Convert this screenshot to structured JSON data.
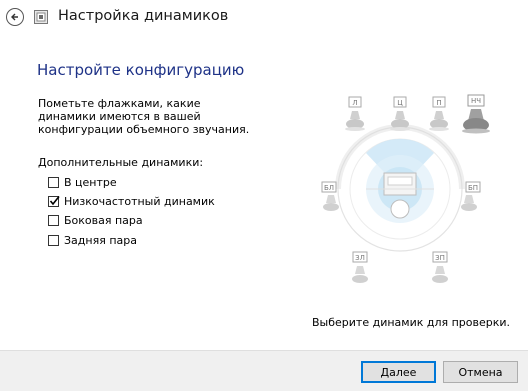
{
  "window": {
    "title": "Настройка динамиков"
  },
  "page": {
    "heading": "Настройте конфигурацию",
    "instructions": "Пометьте флажками, какие динамики имеются в вашей конфигурации объемного звучания.",
    "extra_speakers_label": "Дополнительные динамики:",
    "test_hint": "Выберите динамик для проверки."
  },
  "options": [
    {
      "label": "В центре",
      "checked": false
    },
    {
      "label": "Низкочастотный динамик",
      "checked": true
    },
    {
      "label": "Боковая пара",
      "checked": false
    },
    {
      "label": "Задняя пара",
      "checked": false
    }
  ],
  "speakers": {
    "front_left": "Л",
    "center": "Ц",
    "front_right": "П",
    "subwoofer": "НЧ",
    "side_left": "БЛ",
    "side_right": "БП",
    "rear_left": "ЗЛ",
    "rear_right": "ЗП"
  },
  "buttons": {
    "next": "Далее",
    "cancel": "Отмена"
  },
  "icons": {
    "back": "back-arrow-icon",
    "app": "speaker-setup-icon",
    "check": "checkmark-icon"
  },
  "colors": {
    "heading": "#1e3287",
    "subwoofer_active": "#888888",
    "inactive_speaker": "#c8c8c8",
    "sound_field": "#cfe8f7"
  }
}
